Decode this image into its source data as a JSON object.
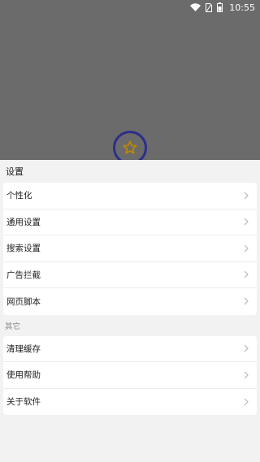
{
  "status_bar": {
    "time": "10:55",
    "icons": [
      "wifi-icon",
      "sim-card-icon",
      "battery-icon"
    ]
  },
  "logo": {
    "icon": "star-icon"
  },
  "sheet": {
    "title": "设置",
    "main_items": [
      {
        "label": "个性化"
      },
      {
        "label": "通用设置"
      },
      {
        "label": "搜索设置"
      },
      {
        "label": "广告拦截"
      },
      {
        "label": "网页脚本"
      }
    ],
    "other_section_label": "其它",
    "other_items": [
      {
        "label": "清理缓存"
      },
      {
        "label": "使用帮助"
      },
      {
        "label": "关于软件"
      }
    ]
  },
  "colors": {
    "backdrop": "#6b6b6b",
    "sheet_background": "#f2f2f2",
    "logo_ring": "#2c2e8c",
    "logo_star": "#b8860b"
  }
}
